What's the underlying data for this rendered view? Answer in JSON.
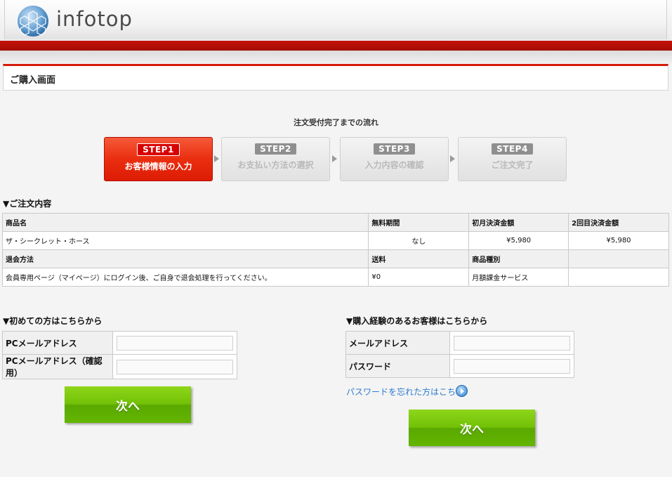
{
  "header": {
    "logo_text": "infotop",
    "logo_icon": "hexagon-globe-icon"
  },
  "page": {
    "title": "ご購入画面"
  },
  "steps": {
    "title": "注文受付完了までの流れ",
    "items": [
      {
        "badge": "STEP1",
        "label": "お客様情報の入力",
        "active": true
      },
      {
        "badge": "STEP2",
        "label": "お支払い方法の選択",
        "active": false
      },
      {
        "badge": "STEP3",
        "label": "入力内容の確認",
        "active": false
      },
      {
        "badge": "STEP4",
        "label": "ご注文完了",
        "active": false
      }
    ]
  },
  "order": {
    "heading": "▼ご注文内容",
    "headers": [
      "商品名",
      "無料期間",
      "初月決済金額",
      "2回目決済金額"
    ],
    "row1": [
      "ザ・シークレット・ホース",
      "なし",
      "¥5,980",
      "¥5,980"
    ],
    "headers2": [
      "退会方法",
      "送料",
      "商品種別",
      ""
    ],
    "row2": [
      "会員専用ページ（マイページ）にログイン後、ご自身で退会処理を行ってください。",
      "¥0",
      "月額課金サービス",
      ""
    ]
  },
  "new_customer": {
    "heading": "▼初めての方はこちらから",
    "email_label": "PCメールアドレス",
    "email_value": "",
    "confirm_label": "PCメールアドレス（確認用）",
    "confirm_value": "",
    "next_label": "次へ"
  },
  "returning_customer": {
    "heading": "▼購入経験のあるお客様はこちらから",
    "email_label": "メールアドレス",
    "email_value": "",
    "password_label": "パスワード",
    "password_value": "",
    "forgot_label": "パスワードを忘れた方はこちら",
    "forgot_icon": "circle-arrow-right-icon",
    "next_label": "次へ"
  },
  "colors": {
    "brand_red": "#c41208",
    "step_active": "#ea2e10",
    "next_green": "#72c106",
    "link_blue": "#2a7bd0"
  }
}
